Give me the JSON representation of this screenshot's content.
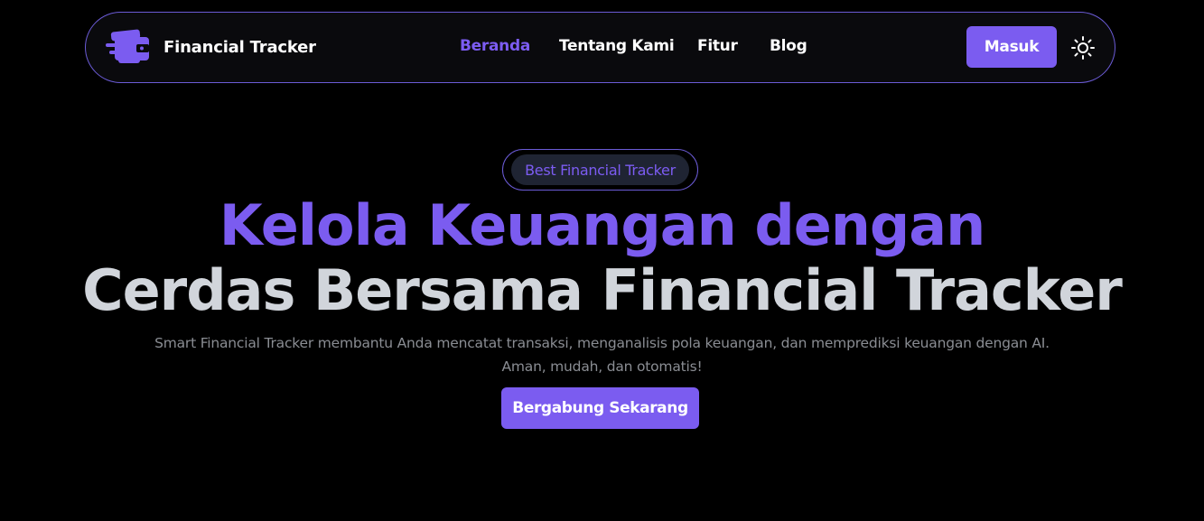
{
  "colors": {
    "accent": "#7b5cf0",
    "background": "#000000",
    "nav_border": "#6b5bd6",
    "heading_light": "#d1d5db",
    "muted_text": "#8a8d93"
  },
  "navbar": {
    "logo_icon": "wallet-speed-icon",
    "brand_name": "Financial Tracker",
    "links": [
      {
        "label": "Beranda",
        "active": true
      },
      {
        "label": "Tentang Kami",
        "active": false
      },
      {
        "label": "Fitur",
        "active": false
      },
      {
        "label": "Blog",
        "active": false
      }
    ],
    "login_label": "Masuk",
    "theme_icon": "sun-icon"
  },
  "hero": {
    "badge": "Best Financial Tracker",
    "title_line_1": "Kelola Keuangan dengan",
    "title_line_2": "Cerdas Bersama Financial Tracker",
    "description": "Smart Financial Tracker membantu Anda mencatat transaksi, menganalisis pola keuangan, dan memprediksi keuangan dengan AI. Aman, mudah, dan otomatis!",
    "cta_label": "Bergabung Sekarang"
  }
}
